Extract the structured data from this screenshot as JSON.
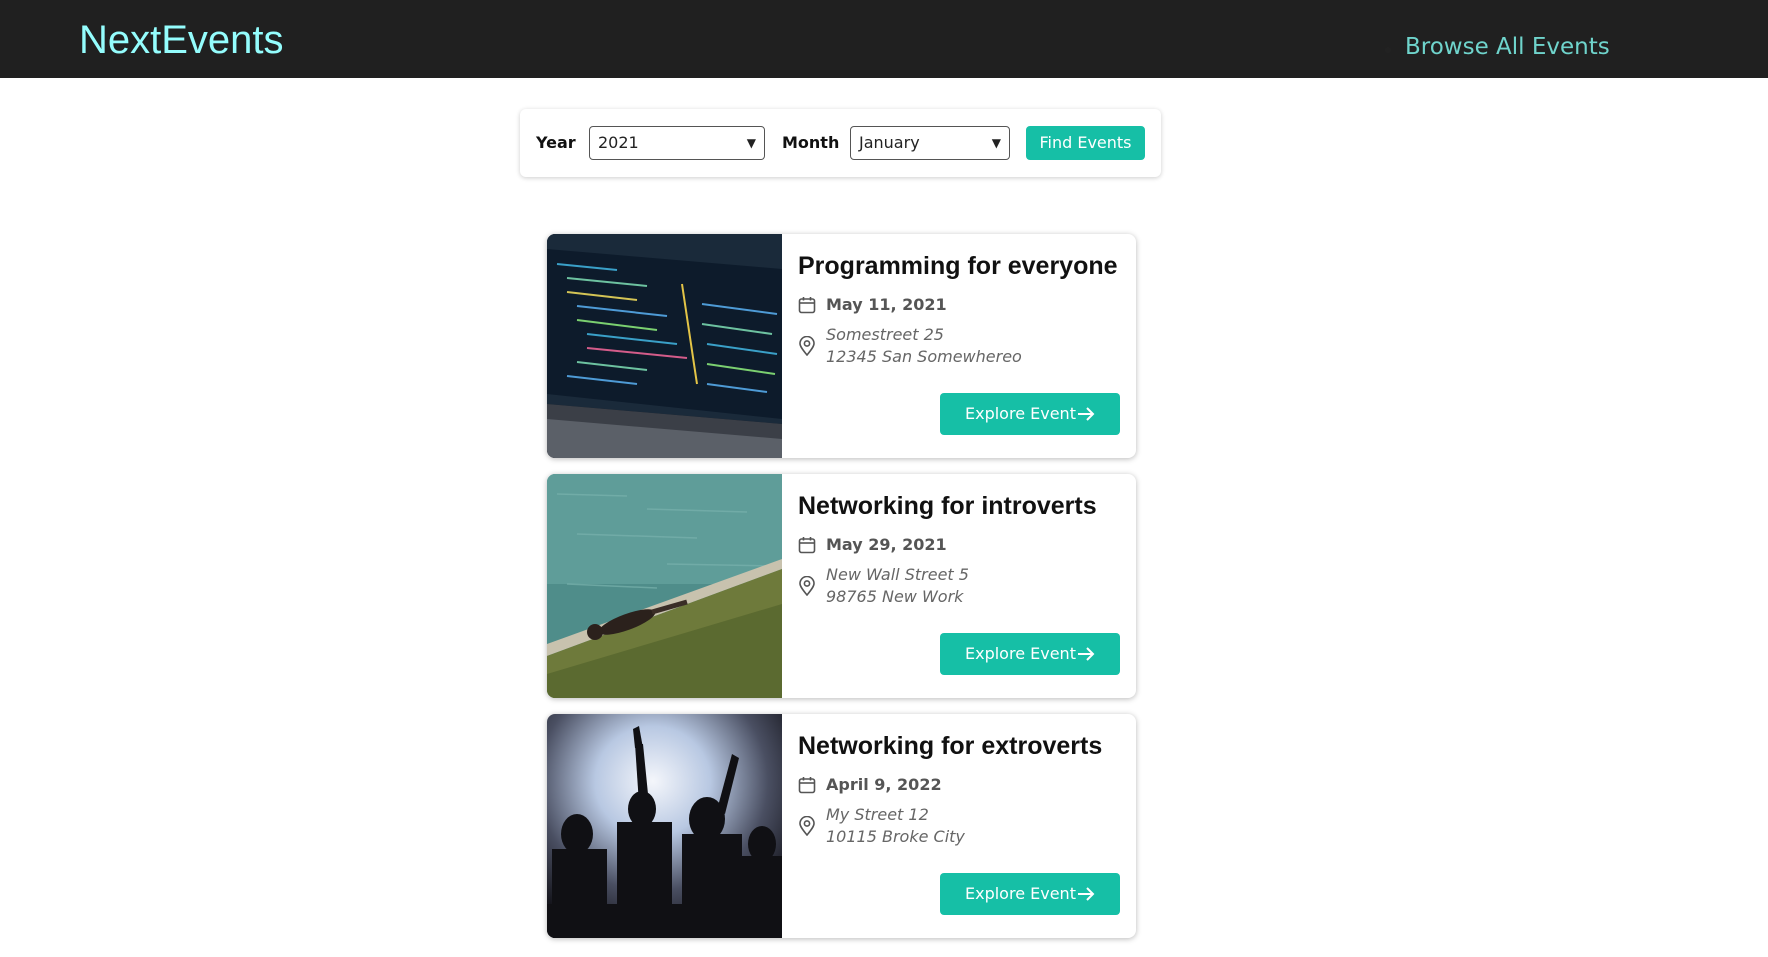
{
  "header": {
    "logo": "NextEvents",
    "nav": [
      "Browse All Events"
    ]
  },
  "filter": {
    "year_label": "Year",
    "year_value": "2021",
    "month_label": "Month",
    "month_value": "January",
    "find_label": "Find Events"
  },
  "events": [
    {
      "title": "Programming for everyone",
      "date": "May 11, 2021",
      "address_line1": "Somestreet 25",
      "address_line2": "12345 San Somewhereo",
      "button": "Explore Event"
    },
    {
      "title": "Networking for introverts",
      "date": "May 29, 2021",
      "address_line1": "New Wall Street 5",
      "address_line2": "98765 New Work",
      "button": "Explore Event"
    },
    {
      "title": "Networking for extroverts",
      "date": "April 9, 2022",
      "address_line1": "My Street 12",
      "address_line2": "10115 Broke City",
      "button": "Explore Event"
    }
  ],
  "icons": {
    "calendar": "calendar-icon",
    "location": "location-pin-icon",
    "arrow": "arrow-right-icon",
    "select": "chevron-down-icon"
  },
  "colors": {
    "header_bg": "#202020",
    "logo": "#94fdfd",
    "nav_link": "#6fd4cc",
    "accent": "#16bfa6"
  }
}
